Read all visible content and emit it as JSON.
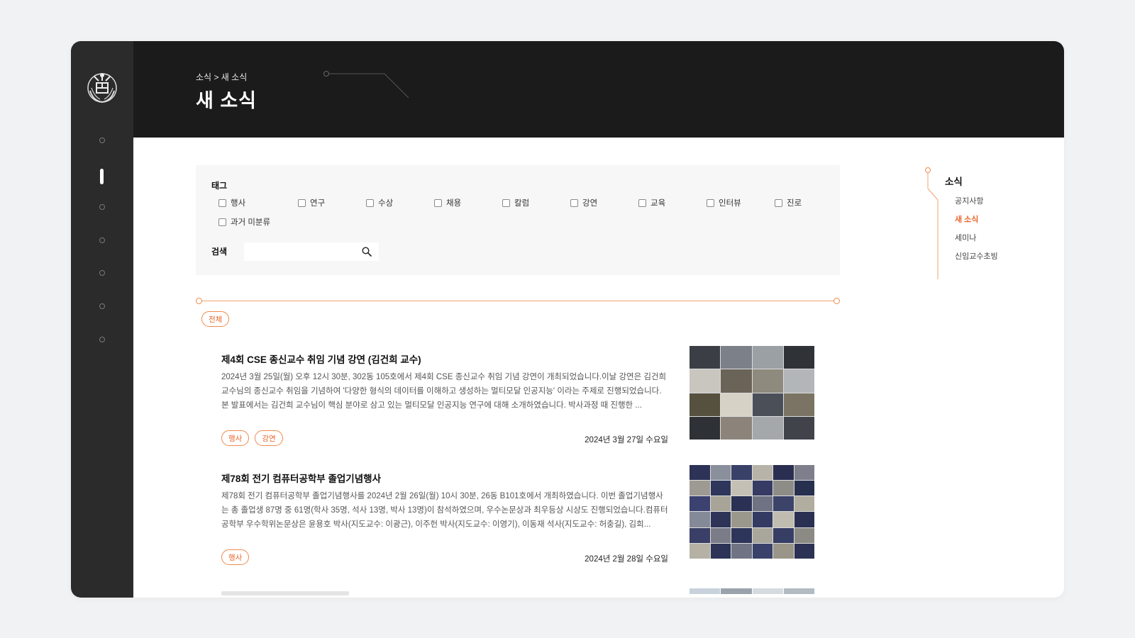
{
  "breadcrumb": {
    "section": "소식",
    "separator": ">",
    "current": "새 소식"
  },
  "page_title": "새 소식",
  "filter": {
    "tag_label": "태그",
    "tags": [
      "행사",
      "연구",
      "수상",
      "채용",
      "칼럼",
      "강연",
      "교육",
      "인터뷰",
      "진로",
      "과거 미분류"
    ],
    "search_label": "검색",
    "search_value": ""
  },
  "active_filter_chip": "전체",
  "posts": [
    {
      "title": "제4회 CSE 종신교수 취임 기념 강연 (김건희 교수)",
      "excerpt": "2024년 3월 25일(월) 오후 12시 30분, 302동 105호에서 제4회 CSE 종신교수 취임 기념 강연이 개최되었습니다.이날 강연은 김건희 교수님의 종신교수 취임을 기념하여 '다양한 형식의 데이터를 이해하고 생성하는 멀티모달 인공지능' 이라는 주제로 진행되었습니다. 본 발표에서는 김건희 교수님이 핵심 분야로 삼고 있는 멀티모달 인공지능 연구에 대해 소개하였습니다. 박사과정 때 진행한 ...",
      "tags": [
        "행사",
        "강연"
      ],
      "date": "2024년 3월 27일 수요일"
    },
    {
      "title": "제78회 전기 컴퓨터공학부 졸업기념행사",
      "excerpt": "제78회 전기 컴퓨터공학부 졸업기념행사를 2024년 2월 26일(월) 10시 30분, 26동 B101호에서 개최하였습니다. 이번 졸업기념행사는 총 졸업생 87명 중 61명(학사 35명, 석사 13명, 박사 13명)이 참석하였으며, 우수논문상과 최우등상 시상도 진행되었습니다.컴퓨터공학부 우수학위논문상은 윤용호 박사(지도교수: 이광근), 이주헌 박사(지도교수: 이영기), 이동재 석사(지도교수: 허충길), 김희...",
      "tags": [
        "행사"
      ],
      "date": "2024년 2월 28일 수요일"
    }
  ],
  "side_nav": {
    "title": "소식",
    "items": [
      "공지사항",
      "새 소식",
      "세미나",
      "신임교수초빙"
    ],
    "active_index": 1
  },
  "colors": {
    "accent": "#e8652b",
    "accent_line": "#f0a470",
    "rail_bg": "#2b2b2b",
    "header_bg": "#1b1b1b",
    "filter_bg": "#f7f7f7",
    "page_bg": "#f1f2f4"
  },
  "icons": {
    "search": "search-icon",
    "logo": "university-emblem"
  }
}
